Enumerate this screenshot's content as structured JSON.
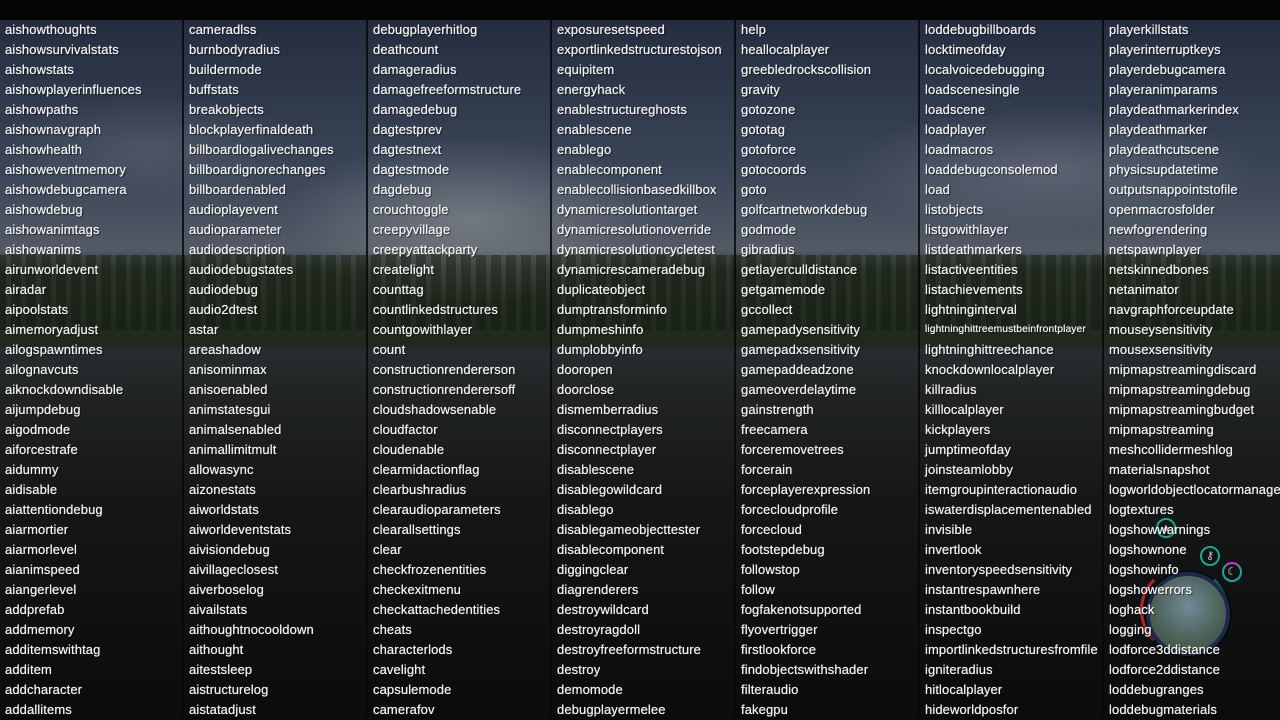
{
  "console": {
    "columns": [
      [
        "aishowthoughts",
        "aishowsurvivalstats",
        "aishowstats",
        "aishowplayerinfluences",
        "aishowpaths",
        "aishownavgraph",
        "aishowhealth",
        "aishoweventmemory",
        "aishowdebugcamera",
        "aishowdebug",
        "aishowanimtags",
        "aishowanims",
        "airunworldevent",
        "airadar",
        "aipoolstats",
        "aimemoryadjust",
        "ailogspawntimes",
        "ailognavcuts",
        "aiknockdowndisable",
        "aijumpdebug",
        "aigodmode",
        "aiforcestrafe",
        "aidummy",
        "aidisable",
        "aiattentiondebug",
        "aiarmortier",
        "aiarmorlevel",
        "aianimspeed",
        "aiangerlevel",
        "addprefab",
        "addmemory",
        "additemswithtag",
        "additem",
        "addcharacter",
        "addallitems"
      ],
      [
        "cameradlss",
        "burnbodyradius",
        "buildermode",
        "buffstats",
        "breakobjects",
        "blockplayerfinaldeath",
        "billboardlogalivechanges",
        "billboardignorechanges",
        "billboardenabled",
        "audioplayevent",
        "audioparameter",
        "audiodescription",
        "audiodebugstates",
        "audiodebug",
        "audio2dtest",
        "astar",
        "areashadow",
        "anisominmax",
        "anisoenabled",
        "animstatesgui",
        "animalsenabled",
        "animallimitmult",
        "allowasync",
        "aizonestats",
        "aiworldstats",
        "aiworldeventstats",
        "aivisiondebug",
        "aivillageclosest",
        "aiverboselog",
        "aivailstats",
        "aithoughtnocooldown",
        "aithought",
        "aitestsleep",
        "aistructurelog",
        "aistatadjust"
      ],
      [
        "debugplayerhitlog",
        "deathcount",
        "damageradius",
        "damagefreeformstructure",
        "damagedebug",
        "dagtestprev",
        "dagtestnext",
        "dagtestmode",
        "dagdebug",
        "crouchtoggle",
        "creepyvillage",
        "creepyattackparty",
        "createlight",
        "counttag",
        "countlinkedstructures",
        "countgowithlayer",
        "count",
        "constructionrendererson",
        "constructionrenderersoff",
        "cloudshadowsenable",
        "cloudfactor",
        "cloudenable",
        "clearmidactionflag",
        "clearbushradius",
        "clearaudioparameters",
        "clearallsettings",
        "clear",
        "checkfrozenentities",
        "checkexitmenu",
        "checkattachedentities",
        "cheats",
        "characterlods",
        "cavelight",
        "capsulemode",
        "camerafov"
      ],
      [
        "exposuresetspeed",
        "exportlinkedstructurestojson",
        "equipitem",
        "energyhack",
        "enablestructureghosts",
        "enablescene",
        "enablego",
        "enablecomponent",
        "enablecollisionbasedkillbox",
        "dynamicresolutiontarget",
        "dynamicresolutionoverride",
        "dynamicresolutioncycletest",
        "dynamicrescameradebug",
        "duplicateobject",
        "dumptransforminfo",
        "dumpmeshinfo",
        "dumplobbyinfo",
        "dooropen",
        "doorclose",
        "dismemberradius",
        "disconnectplayers",
        "disconnectplayer",
        "disablescene",
        "disablegowildcard",
        "disablego",
        "disablegameobjecttester",
        "disablecomponent",
        "diggingclear",
        "diagrenderers",
        "destroywildcard",
        "destroyragdoll",
        "destroyfreeformstructure",
        "destroy",
        "demomode",
        "debugplayermelee"
      ],
      [
        "help",
        "heallocalplayer",
        "greebledrockscollision",
        "gravity",
        "gotozone",
        "gototag",
        "gotoforce",
        "gotocoords",
        "goto",
        "golfcartnetworkdebug",
        "godmode",
        "gibradius",
        "getlayerculldistance",
        "getgamemode",
        "gccollect",
        "gamepadysensitivity",
        "gamepadxsensitivity",
        "gamepaddeadzone",
        "gameoverdelaytime",
        "gainstrength",
        "freecamera",
        "forceremovetrees",
        "forcerain",
        "forceplayerexpression",
        "forcecloudprofile",
        "forcecloud",
        "footstepdebug",
        "followstop",
        "follow",
        "fogfakenotsupported",
        "flyovertrigger",
        "firstlookforce",
        "findobjectswithshader",
        "filteraudio",
        "fakegpu"
      ],
      [
        "loddebugbillboards",
        "locktimeofday",
        "localvoicedebugging",
        "loadscenesingle",
        "loadscene",
        "loadplayer",
        "loadmacros",
        "loaddebugconsolemod",
        "load",
        "listobjects",
        "listgowithlayer",
        "listdeathmarkers",
        "listactiveentities",
        "listachievements",
        "lightninginterval",
        "lightninghittreemustbeinfrontplayer",
        "lightninghittreechance",
        "knockdownlocalplayer",
        "killradius",
        "killlocalplayer",
        "kickplayers",
        "jumptimeofday",
        "joinsteamlobby",
        "itemgroupinteractionaudio",
        "iswaterdisplacementenabled",
        "invisible",
        "invertlook",
        "inventoryspeedsensitivity",
        "instantrespawnhere",
        "instantbookbuild",
        "inspectgo",
        "importlinkedstructuresfromfile",
        "igniteradius",
        "hitlocalplayer",
        "hideworldposfor"
      ],
      [
        "playerkillstats",
        "playerinterruptkeys",
        "playerdebugcamera",
        "playeranimparams",
        "playdeathmarkerindex",
        "playdeathmarker",
        "playdeathcutscene",
        "physicsupdatetime",
        "outputsnappointstofile",
        "openmacrosfolder",
        "newfogrendering",
        "netspawnplayer",
        "netskinnedbones",
        "netanimator",
        "navgraphforceupdate",
        "mouseysensitivity",
        "mousexsensitivity",
        "mipmapstreamingdiscard",
        "mipmapstreamingdebug",
        "mipmapstreamingbudget",
        "mipmapstreaming",
        "meshcollidermeshlog",
        "materialsnapshot",
        "logworldobjectlocatormanagerdata",
        "logtextures",
        "logshowwarnings",
        "logshownone",
        "logshowinfo",
        "logshowerrors",
        "loghack",
        "logging",
        "lodforce3ddistance",
        "lodforce2ddistance",
        "loddebugranges",
        "loddebugmaterials"
      ]
    ]
  },
  "hud": {
    "icons": [
      "tent-icon",
      "key-icon",
      "moon-icon"
    ],
    "minimap": "minimap"
  },
  "colors": {
    "text": "#f2f2f2",
    "hud_teal": "#1aa9a0",
    "hud_red": "#b0242a",
    "hud_magenta": "#d03adf"
  }
}
